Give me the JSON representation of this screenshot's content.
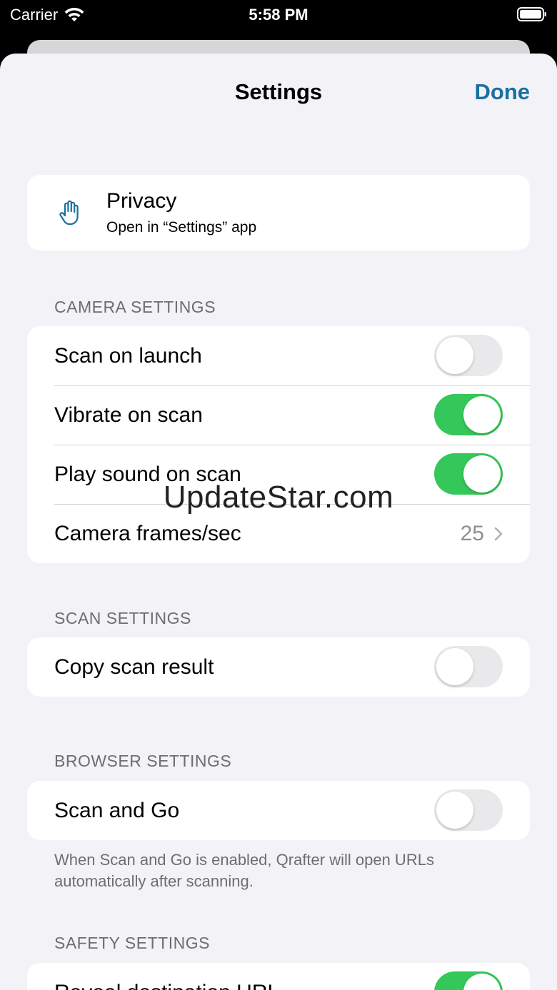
{
  "status": {
    "carrier": "Carrier",
    "time": "5:58 PM"
  },
  "nav": {
    "title": "Settings",
    "done_label": "Done"
  },
  "privacy": {
    "title": "Privacy",
    "subtitle": "Open in “Settings” app"
  },
  "camera": {
    "header": "CAMERA SETTINGS",
    "scan_on_launch": {
      "label": "Scan on launch",
      "on": false
    },
    "vibrate_on_scan": {
      "label": "Vibrate on scan",
      "on": true
    },
    "play_sound_on_scan": {
      "label": "Play sound on scan",
      "on": true
    },
    "frames": {
      "label": "Camera frames/sec",
      "value": "25"
    }
  },
  "scan": {
    "header": "SCAN SETTINGS",
    "copy_result": {
      "label": "Copy scan result",
      "on": false
    }
  },
  "browser": {
    "header": "BROWSER SETTINGS",
    "scan_and_go": {
      "label": "Scan and Go",
      "on": false
    },
    "footer": "When Scan and Go is enabled, Qrafter will open URLs automatically after scanning."
  },
  "safety": {
    "header": "SAFETY SETTINGS",
    "reveal_url": {
      "label": "Reveal destination URL",
      "on": true
    }
  },
  "watermark": "UpdateStar.com",
  "colors": {
    "accent": "#1a6fa0",
    "toggle_on": "#34c759",
    "toggle_off": "#e9e9eb",
    "background": "#f2f2f7"
  }
}
